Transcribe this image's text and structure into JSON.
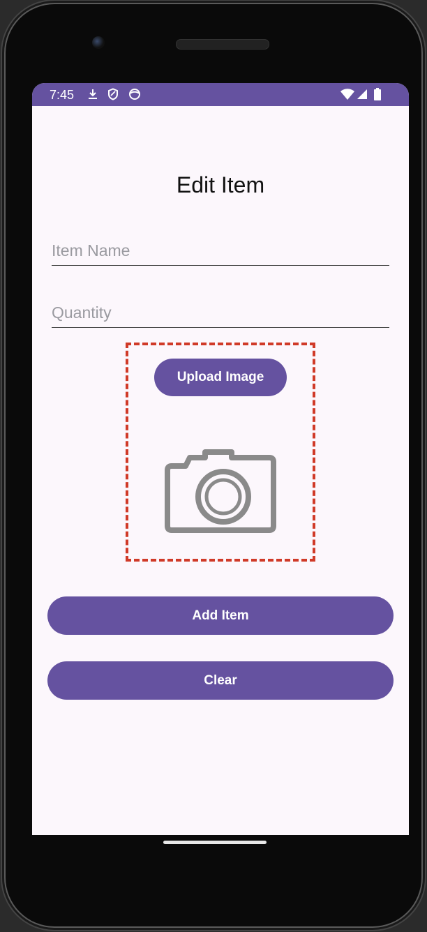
{
  "status_bar": {
    "time": "7:45",
    "background": "#6552a0",
    "left_icons": [
      "download-icon",
      "shield-icon",
      "face-icon"
    ],
    "right_icons": [
      "wifi-icon",
      "signal-icon",
      "battery-icon"
    ]
  },
  "page": {
    "title": "Edit Item"
  },
  "form": {
    "item_name": {
      "value": "",
      "placeholder": "Item Name"
    },
    "quantity": {
      "value": "",
      "placeholder": "Quantity"
    }
  },
  "image_section": {
    "upload_label": "Upload Image",
    "placeholder_icon": "camera-icon",
    "border_color": "#d03a28"
  },
  "actions": {
    "add_label": "Add Item",
    "clear_label": "Clear"
  },
  "colors": {
    "accent": "#6552a0",
    "screen_background": "#fcf7fc"
  }
}
